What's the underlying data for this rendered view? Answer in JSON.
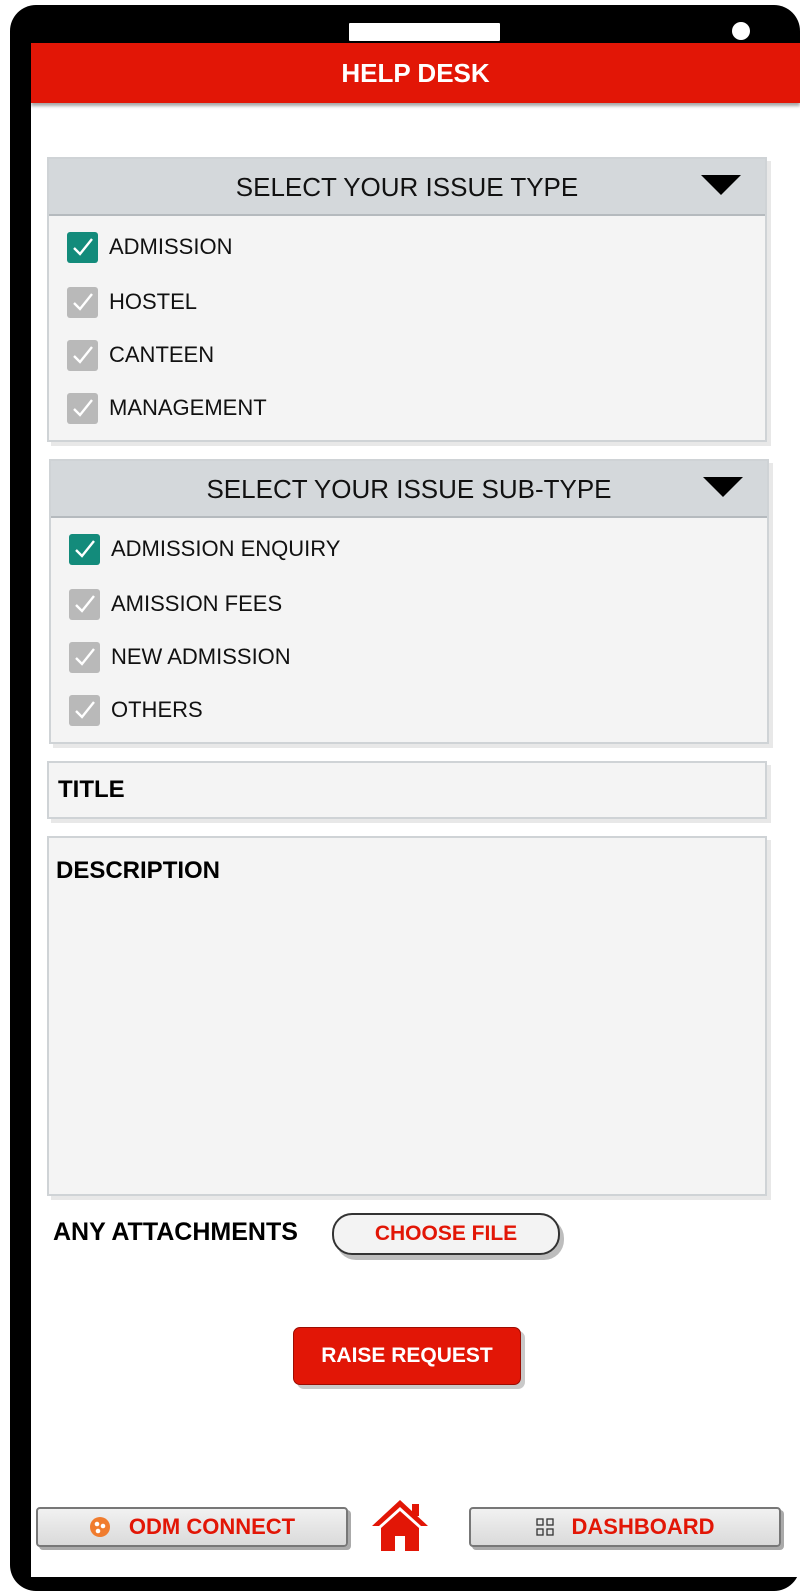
{
  "header": {
    "title": "HELP DESK"
  },
  "issue_type": {
    "label": "SELECT YOUR ISSUE TYPE",
    "options": [
      {
        "label": "ADMISSION",
        "checked": true
      },
      {
        "label": "HOSTEL",
        "checked": false
      },
      {
        "label": "CANTEEN",
        "checked": false
      },
      {
        "label": "MANAGEMENT",
        "checked": false
      }
    ]
  },
  "issue_subtype": {
    "label": "SELECT YOUR ISSUE SUB-TYPE",
    "options": [
      {
        "label": "ADMISSION ENQUIRY",
        "checked": true
      },
      {
        "label": "AMISSION FEES",
        "checked": false
      },
      {
        "label": "NEW ADMISSION",
        "checked": false
      },
      {
        "label": "OTHERS",
        "checked": false
      }
    ]
  },
  "form": {
    "title_label": "TITLE",
    "description_label": "DESCRIPTION",
    "attachments_label": "ANY ATTACHMENTS",
    "choose_file_label": "CHOOSE FILE",
    "submit_label": "RAISE REQUEST"
  },
  "bottom_nav": {
    "left_label": "ODM CONNECT",
    "right_label": "DASHBOARD",
    "left_icon": "odm-connect-icon",
    "center_icon": "home-icon",
    "right_icon": "grid-icon"
  },
  "colors": {
    "brand_red": "#e21606",
    "checked_green": "#138b7b",
    "unchecked_gray": "#b9b9b9",
    "panel_header": "#d4d8db"
  }
}
